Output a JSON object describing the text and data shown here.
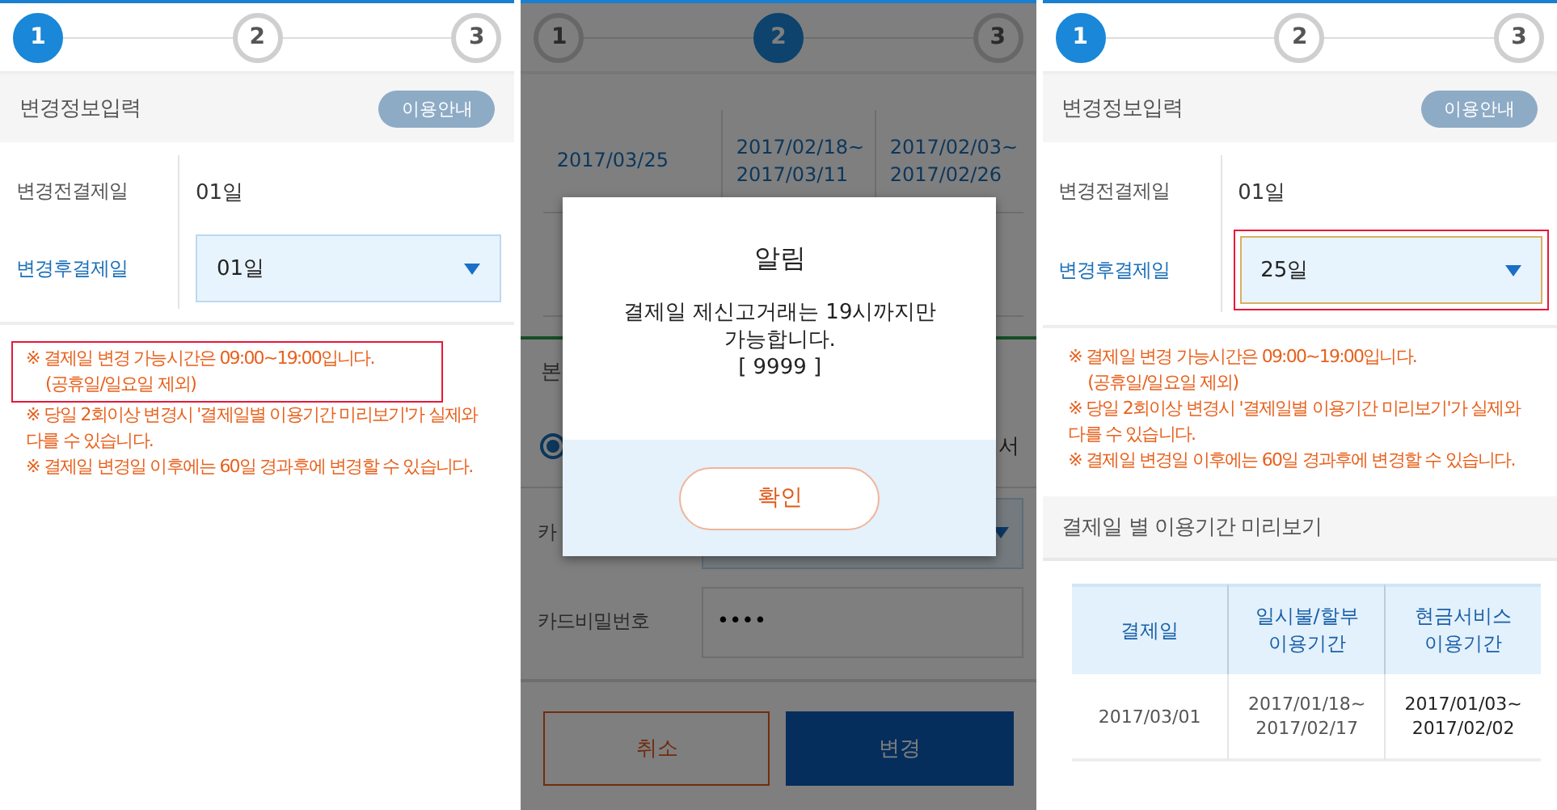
{
  "panels": [
    {
      "kind": "form",
      "steps": [
        {
          "label": "1",
          "selected": true
        },
        {
          "label": "2",
          "selected": false
        },
        {
          "label": "3",
          "selected": false
        }
      ],
      "section_title": "변경정보입력",
      "guide_button": "이용안내",
      "fields": [
        {
          "label": "변경전결제일",
          "value": "01일",
          "kind": "text"
        },
        {
          "label": "변경후결제일",
          "value": "01일",
          "kind": "select",
          "marked": false
        }
      ],
      "notes": [
        {
          "text": "※ 결제일 변경 가능시간은 09:00~19:00입니다.",
          "continuation": "(공휴일/일요일 제외)",
          "marked": true
        },
        {
          "text": "※ 당일 2회이상 변경시 '결제일별 이용기간 미리보기'가 실제와 다를 수 있습니다.",
          "marked": false
        },
        {
          "text": "※ 결제일 변경일 이후에는 60일 경과후에 변경할 수 있습니다.",
          "marked": false
        }
      ]
    },
    {
      "kind": "dialog",
      "steps": [
        {
          "label": "1",
          "selected": false
        },
        {
          "label": "2",
          "selected": true
        },
        {
          "label": "3",
          "selected": false
        }
      ],
      "rows": [
        [
          "2017/03/25",
          "2017/02/18~ 2017/03/11",
          "2017/02/03~ 2017/02/26"
        ]
      ],
      "section_title": "본",
      "radio": {
        "selected": true,
        "label": "서"
      },
      "fields": [
        {
          "label": "카",
          "kind": "select"
        },
        {
          "label": "카드비밀번호",
          "kind": "password",
          "value": "••••"
        }
      ],
      "buttons": [
        {
          "label": "취소",
          "kind": "secondary"
        },
        {
          "label": "변경",
          "kind": "primary"
        }
      ],
      "dialog": {
        "title": "알림",
        "message": [
          "결제일 제신고거래는 19시까지만",
          "가능합니다.",
          "[ 9999 ]"
        ],
        "button": "확인"
      }
    },
    {
      "kind": "form",
      "steps": [
        {
          "label": "1",
          "selected": true
        },
        {
          "label": "2",
          "selected": false
        },
        {
          "label": "3",
          "selected": false
        }
      ],
      "section_title": "변경정보입력",
      "guide_button": "이용안내",
      "fields": [
        {
          "label": "변경전결제일",
          "value": "01일",
          "kind": "text"
        },
        {
          "label": "변경후결제일",
          "value": "25일",
          "kind": "select",
          "marked": true
        }
      ],
      "notes": [
        {
          "text": "※ 결제일 변경 가능시간은 09:00~19:00입니다.",
          "continuation": "(공휴일/일요일 제외)",
          "marked": false
        },
        {
          "text": "※ 당일 2회이상 변경시 '결제일별 이용기간 미리보기'가 실제와 다를 수 있습니다.",
          "marked": false
        },
        {
          "text": "※ 결제일 변경일 이후에는 60일 경과후에 변경할 수 있습니다.",
          "marked": false
        }
      ],
      "preview": {
        "title": "결제일 별 이용기간 미리보기",
        "columns": [
          "결제일",
          "일시불/할부 이용기간",
          "현금서비스 이용기간"
        ],
        "rows": [
          [
            "2017/03/01",
            "2017/01/18~ 2017/02/17",
            "2017/01/03~ 2017/02/02"
          ]
        ]
      }
    }
  ]
}
